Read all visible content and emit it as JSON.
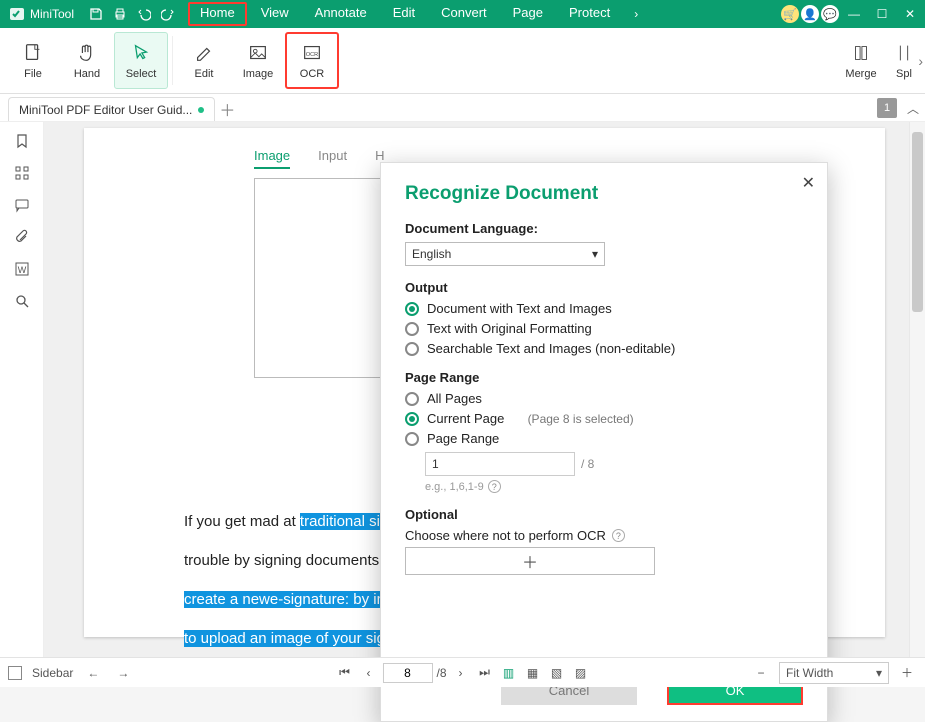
{
  "titlebar": {
    "app_name": "MiniTool",
    "menus": [
      "Home",
      "View",
      "Annotate",
      "Edit",
      "Convert",
      "Page",
      "Protect"
    ]
  },
  "ribbon": {
    "file": "File",
    "hand": "Hand",
    "select": "Select",
    "edit": "Edit",
    "image": "Image",
    "ocr": "OCR",
    "merge": "Merge",
    "split": "Spl"
  },
  "doctab": {
    "title": "MiniTool PDF Editor User Guid...",
    "page_badge": "1"
  },
  "page_tabs": {
    "image": "Image",
    "input": "Input",
    "other": "H"
  },
  "doc_text": {
    "line1a": "If you get mad at ",
    "line1b": "traditional sig",
    "line2": "trouble by signing documents o",
    "line3": "create a newe-signature: by ima",
    "line4": "to upload an image of your sign"
  },
  "dialog": {
    "title": "Recognize Document",
    "lang_label": "Document Language:",
    "lang_value": "English",
    "output_label": "Output",
    "out_opt1": "Document with Text and Images",
    "out_opt2": "Text with Original Formatting",
    "out_opt3": "Searchable Text and Images (non-editable)",
    "range_label": "Page Range",
    "range_all": "All Pages",
    "range_current": "Current Page",
    "range_current_hint": "(Page 8 is selected)",
    "range_pr": "Page Range",
    "range_input": "1",
    "range_of": "/ 8",
    "range_eg": "e.g., 1,6,1-9",
    "optional_label": "Optional",
    "optional_hint": "Choose where not to perform OCR",
    "cancel": "Cancel",
    "ok": "OK"
  },
  "statusbar": {
    "sidebar_label": "Sidebar",
    "page_current": "8",
    "page_total": "/8",
    "fit_label": "Fit Width"
  }
}
